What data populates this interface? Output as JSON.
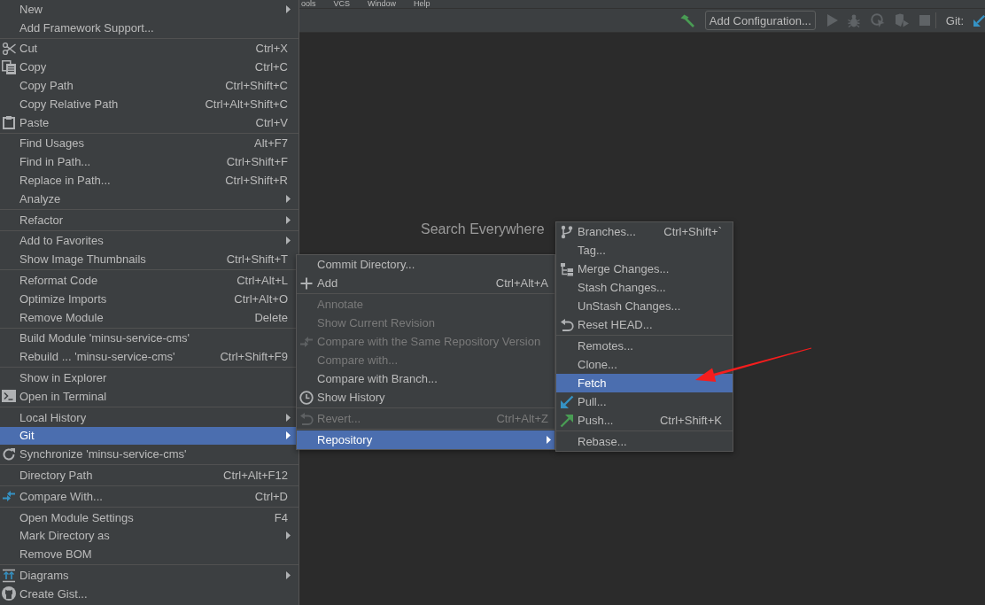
{
  "menubar": {
    "items": [
      "ools",
      "VCS",
      "Window",
      "Help"
    ]
  },
  "toolbar": {
    "config_button": "Add Configuration...",
    "vcs_label": "Git:"
  },
  "editor": {
    "hint": "Search Everywhere"
  },
  "context_menu": {
    "sections": [
      {
        "items": [
          {
            "label": "New",
            "submenu": true,
            "selected": false
          },
          {
            "label": "Add Framework Support...",
            "submenu": false,
            "selected": false
          }
        ]
      },
      {
        "items": [
          {
            "label": "Cut",
            "shortcut": "Ctrl+X",
            "submenu": false,
            "selected": false
          },
          {
            "label": "Copy",
            "shortcut": "Ctrl+C",
            "submenu": false,
            "selected": false
          },
          {
            "label": "Copy Path",
            "shortcut": "Ctrl+Shift+C",
            "submenu": false,
            "selected": false
          },
          {
            "label": "Copy Relative Path",
            "shortcut": "Ctrl+Alt+Shift+C",
            "submenu": false,
            "selected": false
          },
          {
            "label": "Paste",
            "shortcut": "Ctrl+V",
            "submenu": false,
            "selected": false
          }
        ]
      },
      {
        "items": [
          {
            "label": "Find Usages",
            "shortcut": "Alt+F7",
            "submenu": false,
            "selected": false
          },
          {
            "label": "Find in Path...",
            "shortcut": "Ctrl+Shift+F",
            "submenu": false,
            "selected": false
          },
          {
            "label": "Replace in Path...",
            "shortcut": "Ctrl+Shift+R",
            "submenu": false,
            "selected": false
          },
          {
            "label": "Analyze",
            "submenu": true,
            "selected": false
          }
        ]
      },
      {
        "items": [
          {
            "label": "Refactor",
            "submenu": true,
            "selected": false
          }
        ]
      },
      {
        "items": [
          {
            "label": "Add to Favorites",
            "submenu": true,
            "selected": false
          },
          {
            "label": "Show Image Thumbnails",
            "shortcut": "Ctrl+Shift+T",
            "submenu": false,
            "selected": false
          }
        ]
      },
      {
        "items": [
          {
            "label": "Reformat Code",
            "shortcut": "Ctrl+Alt+L",
            "submenu": false,
            "selected": false
          },
          {
            "label": "Optimize Imports",
            "shortcut": "Ctrl+Alt+O",
            "submenu": false,
            "selected": false
          },
          {
            "label": "Remove Module",
            "shortcut": "Delete",
            "submenu": false,
            "selected": false
          }
        ]
      },
      {
        "items": [
          {
            "label": "Build Module 'minsu-service-cms'",
            "submenu": false,
            "selected": false
          },
          {
            "label": "Rebuild ... 'minsu-service-cms'",
            "shortcut": "Ctrl+Shift+F9",
            "submenu": false,
            "selected": false
          }
        ]
      },
      {
        "items": [
          {
            "label": "Show in Explorer",
            "submenu": false,
            "selected": false
          },
          {
            "label": "Open in Terminal",
            "submenu": false,
            "selected": false
          }
        ]
      },
      {
        "items": [
          {
            "label": "Local History",
            "submenu": true,
            "selected": false
          },
          {
            "label": "Git",
            "submenu": true,
            "selected": true
          },
          {
            "label": "Synchronize 'minsu-service-cms'",
            "submenu": false,
            "selected": false
          }
        ]
      },
      {
        "items": [
          {
            "label": "Directory Path",
            "shortcut": "Ctrl+Alt+F12",
            "submenu": false,
            "selected": false
          }
        ]
      },
      {
        "items": [
          {
            "label": "Compare With...",
            "shortcut": "Ctrl+D",
            "submenu": false,
            "selected": false
          }
        ]
      },
      {
        "items": [
          {
            "label": "Open Module Settings",
            "shortcut": "F4",
            "submenu": false,
            "selected": false
          },
          {
            "label": "Mark Directory as",
            "submenu": true,
            "selected": false
          },
          {
            "label": "Remove BOM",
            "submenu": false,
            "selected": false
          }
        ]
      },
      {
        "items": [
          {
            "label": "Diagrams",
            "submenu": true,
            "selected": false
          },
          {
            "label": "Create Gist...",
            "submenu": false,
            "selected": false
          }
        ]
      }
    ]
  },
  "git_submenu": {
    "sections": [
      {
        "items": [
          {
            "label": "Commit Directory...",
            "submenu": false,
            "disabled": false,
            "selected": false
          },
          {
            "label": "Add",
            "shortcut": "Ctrl+Alt+A",
            "submenu": false,
            "disabled": false,
            "selected": false
          }
        ]
      },
      {
        "items": [
          {
            "label": "Annotate",
            "submenu": false,
            "disabled": true,
            "selected": false
          },
          {
            "label": "Show Current Revision",
            "submenu": false,
            "disabled": true,
            "selected": false
          },
          {
            "label": "Compare with the Same Repository Version",
            "submenu": false,
            "disabled": true,
            "selected": false
          },
          {
            "label": "Compare with...",
            "submenu": false,
            "disabled": true,
            "selected": false
          },
          {
            "label": "Compare with Branch...",
            "submenu": false,
            "disabled": false,
            "selected": false
          },
          {
            "label": "Show History",
            "submenu": false,
            "disabled": false,
            "selected": false
          }
        ]
      },
      {
        "items": [
          {
            "label": "Revert...",
            "shortcut": "Ctrl+Alt+Z",
            "submenu": false,
            "disabled": true,
            "selected": false
          }
        ]
      },
      {
        "items": [
          {
            "label": "Repository",
            "submenu": true,
            "disabled": false,
            "selected": true
          }
        ]
      }
    ]
  },
  "repository_submenu": {
    "sections": [
      {
        "items": [
          {
            "label": "Branches...",
            "shortcut": "Ctrl+Shift+`",
            "selected": false
          },
          {
            "label": "Tag...",
            "selected": false
          },
          {
            "label": "Merge Changes...",
            "selected": false
          },
          {
            "label": "Stash Changes...",
            "selected": false
          },
          {
            "label": "UnStash Changes...",
            "selected": false
          },
          {
            "label": "Reset HEAD...",
            "selected": false
          }
        ]
      },
      {
        "items": [
          {
            "label": "Remotes...",
            "selected": false
          },
          {
            "label": "Clone...",
            "selected": false
          },
          {
            "label": "Fetch",
            "selected": true
          },
          {
            "label": "Pull...",
            "selected": false
          },
          {
            "label": "Push...",
            "shortcut": "Ctrl+Shift+K",
            "selected": false
          }
        ]
      },
      {
        "items": [
          {
            "label": "Rebase...",
            "selected": false
          }
        ]
      }
    ]
  }
}
